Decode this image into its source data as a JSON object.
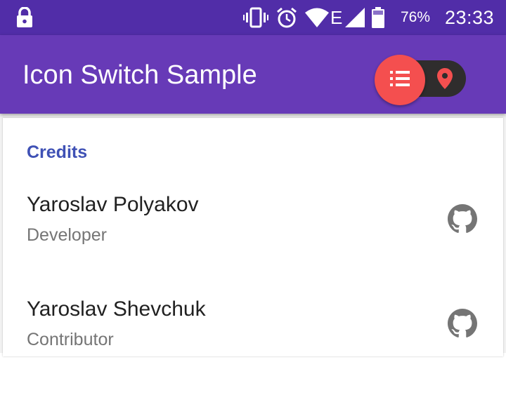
{
  "status_bar": {
    "battery_percent": "76%",
    "time": "23:33",
    "network_type": "E",
    "icons": [
      "lock-icon",
      "vibrate-icon",
      "alarm-icon",
      "wifi-icon",
      "cellular-signal-icon",
      "battery-icon"
    ]
  },
  "app_bar": {
    "title": "Icon Switch Sample",
    "icon_switch": {
      "left_icon": "list-icon",
      "right_icon": "location-pin-icon",
      "selected": "left"
    }
  },
  "credits": {
    "header": "Credits",
    "items": [
      {
        "name": "Yaroslav Polyakov",
        "role": "Developer",
        "icon": "github-icon"
      },
      {
        "name": "Yaroslav Shevchuk",
        "role": "Contributor",
        "icon": "github-icon"
      }
    ]
  },
  "colors": {
    "status_bar": "#512da8",
    "app_bar": "#673ab7",
    "switch_thumb": "#f44f4f",
    "switch_track": "#2f2d2d",
    "section_header": "#3f51b5"
  }
}
